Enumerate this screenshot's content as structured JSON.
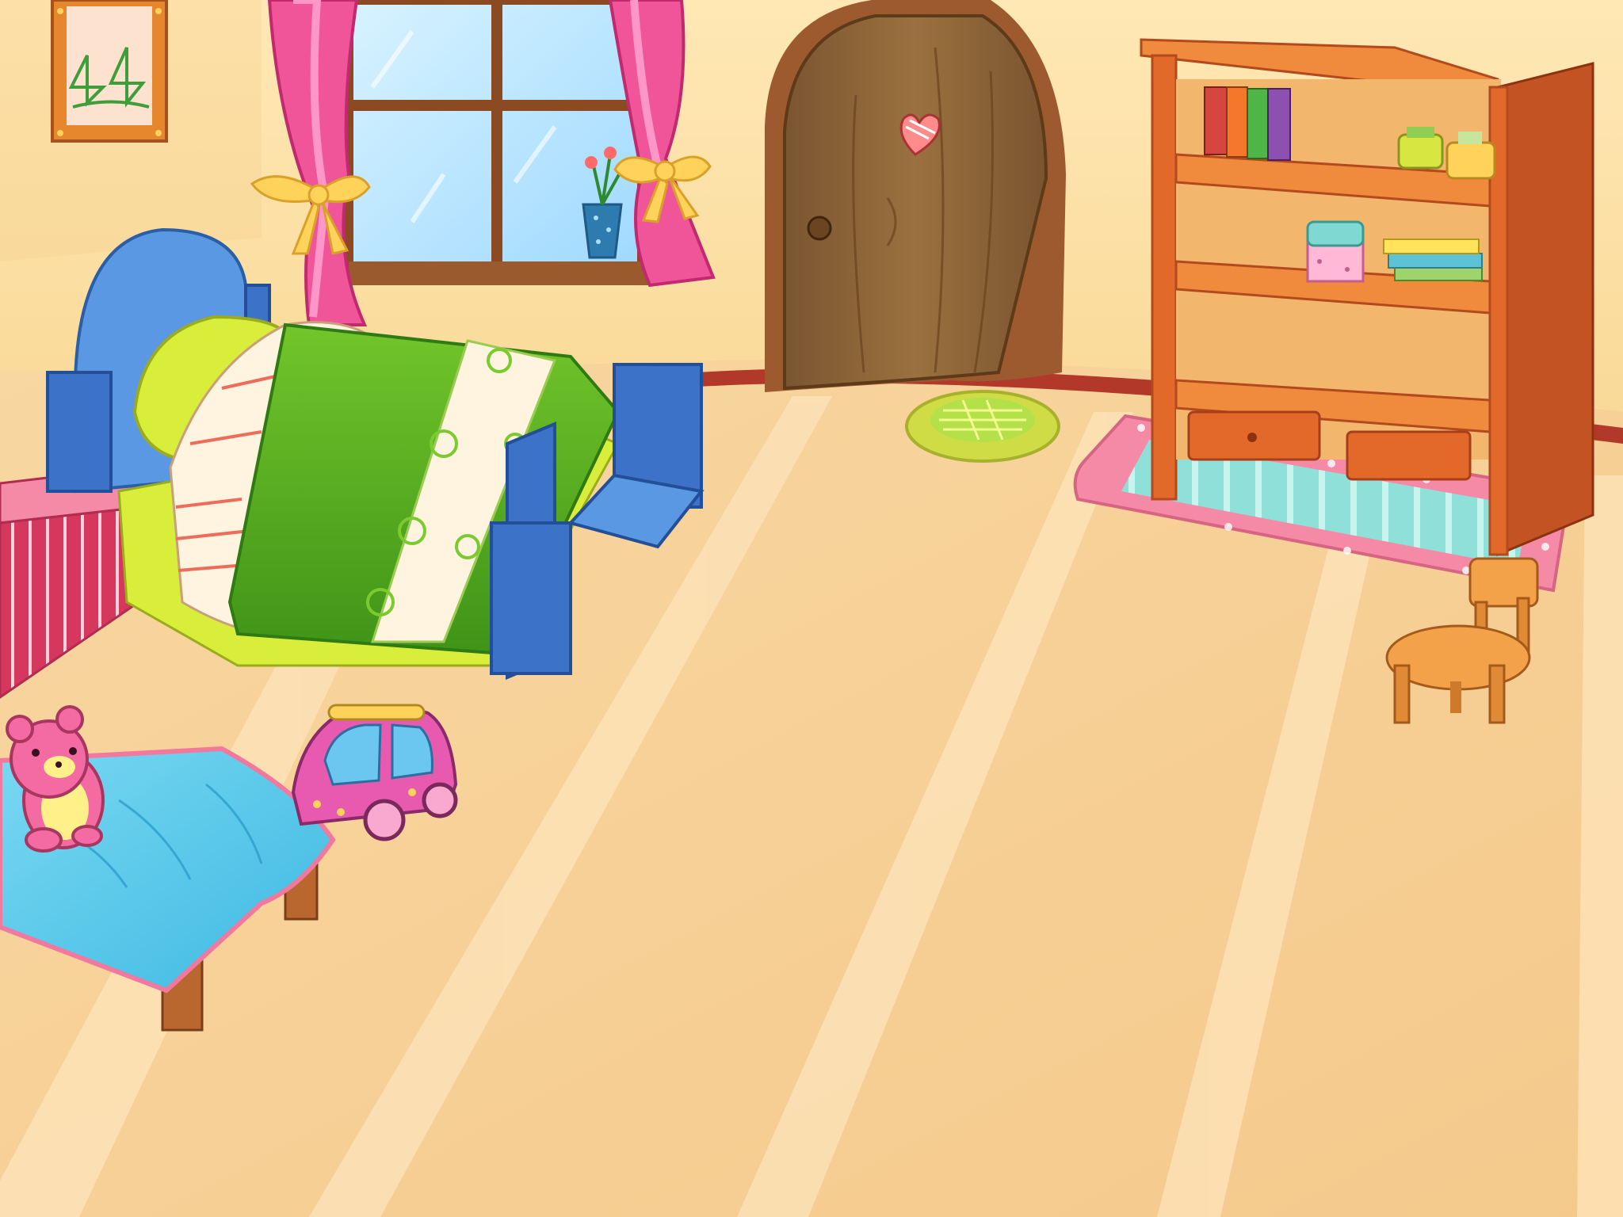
{
  "scene": {
    "kind": "cartoon-bedroom-background",
    "objects": [
      "wall",
      "floor",
      "picture-frame",
      "window",
      "curtains",
      "flower-vase",
      "door",
      "heart-ornament",
      "round-rug",
      "bookshelf",
      "books",
      "jars",
      "gift-box",
      "rectangular-rug",
      "bed",
      "pillow",
      "blanket",
      "bench",
      "small-chair",
      "side-table",
      "teddy-bear",
      "toy-car"
    ]
  },
  "palette": {
    "wall": "#fbe0a4",
    "wall_shadow": "#f2c98c",
    "floor": "#f7d39c",
    "floor_stripe": "#fde2b6",
    "baseboard": "#b2382a",
    "curtain": "#f0559a",
    "curtain_light": "#ff8cc3",
    "bow": "#ffd25a",
    "window_frame": "#8b4a22",
    "glass": "#bfe8ff",
    "door": "#8a6033",
    "door_light": "#a57a47",
    "door_frame": "#9c5a2e",
    "shelf": "#e3692a",
    "shelf_light": "#f08a3d",
    "shelf_dark": "#b24a1e",
    "bed_frame": "#3c73c8",
    "bed_frame_light": "#5b98e4",
    "pillow": "#d8ee3a",
    "blanket": "#58ac22",
    "blanket_light": "#7ccb2e",
    "sheet": "#fff4e0",
    "bench": "#d6375c",
    "table_cloth": "#55c9ea",
    "table_leg": "#b9672f",
    "teddy": "#f46aa2",
    "car": "#e85ab0",
    "car_window": "#6cc7f0",
    "chair": "#f3a24a",
    "rug_pink": "#f58aa6",
    "rug_teal": "#7fd8d2",
    "round_rug": "#cfdc45"
  }
}
